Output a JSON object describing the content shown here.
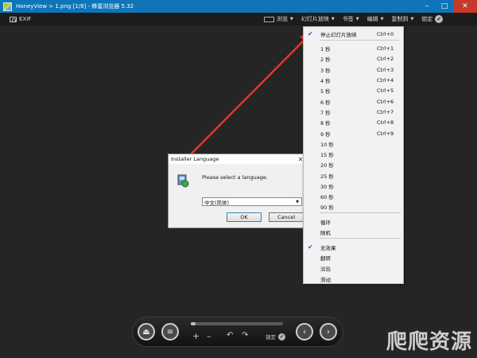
{
  "window": {
    "title": "HoneyView > 1.png [1/8] - 蜂蜜浏览器 5.32"
  },
  "toolbar": {
    "exif_label": "EXIF",
    "menus": [
      {
        "label": "浏览"
      },
      {
        "label": "幻灯片放映"
      },
      {
        "label": "书签"
      },
      {
        "label": "编辑"
      },
      {
        "label": "复制到"
      }
    ],
    "lock_label": "锁定"
  },
  "slideshow_menu": {
    "items": [
      {
        "label": "停止幻灯片放映",
        "shortcut": "Ctrl+0",
        "checked": true
      },
      {
        "label": "1 秒",
        "shortcut": "Ctrl+1"
      },
      {
        "label": "2 秒",
        "shortcut": "Ctrl+2"
      },
      {
        "label": "3 秒",
        "shortcut": "Ctrl+3"
      },
      {
        "label": "4 秒",
        "shortcut": "Ctrl+4"
      },
      {
        "label": "5 秒",
        "shortcut": "Ctrl+5"
      },
      {
        "label": "6 秒",
        "shortcut": "Ctrl+6"
      },
      {
        "label": "7 秒",
        "shortcut": "Ctrl+7"
      },
      {
        "label": "8 秒",
        "shortcut": "Ctrl+8"
      },
      {
        "label": "9 秒",
        "shortcut": "Ctrl+9"
      },
      {
        "label": "10 秒",
        "shortcut": ""
      },
      {
        "label": "15 秒",
        "shortcut": ""
      },
      {
        "label": "20 秒",
        "shortcut": ""
      },
      {
        "label": "25 秒",
        "shortcut": ""
      },
      {
        "label": "30 秒",
        "shortcut": ""
      },
      {
        "label": "60 秒",
        "shortcut": ""
      },
      {
        "label": "90 秒",
        "shortcut": ""
      },
      {
        "label": "循环",
        "shortcut": ""
      },
      {
        "label": "随机",
        "shortcut": ""
      },
      {
        "label": "无效果",
        "shortcut": "",
        "checked": true
      },
      {
        "label": "翻转",
        "shortcut": ""
      },
      {
        "label": "淡出",
        "shortcut": ""
      },
      {
        "label": "滑动",
        "shortcut": ""
      }
    ]
  },
  "dialog": {
    "title": "Installer Language",
    "message": "Please select a language.",
    "selected_language": "中文(简体)",
    "ok_label": "OK",
    "cancel_label": "Cancel"
  },
  "controls": {
    "lock_label": "锁定",
    "progress_fraction": 0.05
  },
  "watermark": "爬爬资源",
  "colors": {
    "titlebar": "#0f75b8",
    "arrow": "#e8332a",
    "close": "#c7392b"
  }
}
